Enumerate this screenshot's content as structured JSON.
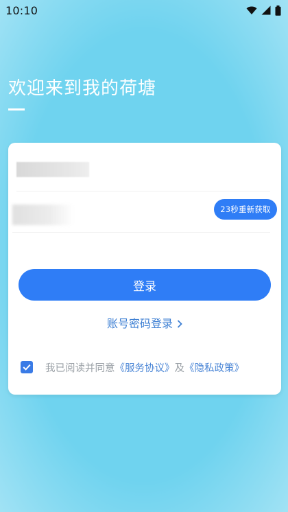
{
  "status_bar": {
    "time": "10:10",
    "icons": [
      "wifi-icon",
      "signal-icon",
      "battery-icon"
    ]
  },
  "header": {
    "title": "欢迎来到我的荷塘"
  },
  "form": {
    "phone_value": "",
    "code_value": "",
    "resend_label": "23秒重新获取",
    "login_label": "登录",
    "password_login_label": "账号密码登录",
    "agreement": {
      "prefix": "我已阅读并同意",
      "service_link": "《服务协议》",
      "conjunction": "及",
      "privacy_link": "《隐私政策》",
      "checked": true
    }
  },
  "colors": {
    "background": "#6fd3ef",
    "primary": "#2f7df6",
    "link": "#4b86d6",
    "muted_text": "#9aa0a6"
  }
}
